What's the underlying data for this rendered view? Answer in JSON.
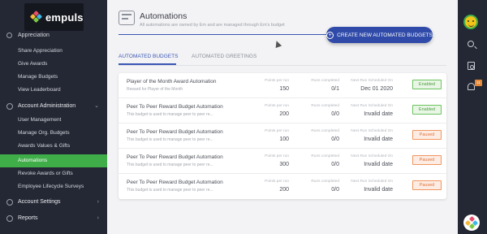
{
  "brand": {
    "name": "empuls"
  },
  "sidebar": {
    "cut_section": "Appreciation",
    "appreciation_items": [
      {
        "label": "Share Appreciation"
      },
      {
        "label": "Give Awards"
      },
      {
        "label": "Manage Budgets"
      },
      {
        "label": "View Leaderboard"
      }
    ],
    "account_admin": {
      "label": "Account Administration"
    },
    "admin_items": [
      {
        "label": "User Management"
      },
      {
        "label": "Manage Org. Budgets"
      },
      {
        "label": "Awards Values & Gifts"
      },
      {
        "label": "Automations",
        "active": true
      },
      {
        "label": "Revoke Awards or Gifts"
      },
      {
        "label": "Employee Lifecycle Surveys"
      }
    ],
    "account_settings": {
      "label": "Account Settings"
    },
    "reports": {
      "label": "Reports"
    }
  },
  "header": {
    "title": "Automations",
    "subtitle": "All automations are owned by Em and are managed through Em's budget",
    "create_button": "CREATE NEW AUTOMATED BUDGETS"
  },
  "tabs": [
    {
      "label": "AUTOMATED BUDGETS",
      "active": true
    },
    {
      "label": "AUTOMATED GREETINGS",
      "active": false
    }
  ],
  "columns": {
    "points": "Points per run",
    "runs": "Runs completed",
    "next": "Next Run Scheduled On"
  },
  "rows": [
    {
      "name": "Player of the Month Award Automation",
      "desc": "Reward for Player of the Month",
      "points": "150",
      "runs": "0/1",
      "next": "Dec 01 2020",
      "status": "Enabled"
    },
    {
      "name": "Peer To Peer Reward Budget Automation",
      "desc": "This budget is used to manage peer to peer re...",
      "points": "200",
      "runs": "0/0",
      "next": "Invalid date",
      "status": "Enabled"
    },
    {
      "name": "Peer To Peer Reward Budget Automation",
      "desc": "This budget is used to manage peer to peer re...",
      "points": "100",
      "runs": "0/0",
      "next": "Invalid date",
      "status": "Paused"
    },
    {
      "name": "Peer To Peer Reward Budget Automation",
      "desc": "This budget is used to manage peer to peer re...",
      "points": "300",
      "runs": "0/0",
      "next": "Invalid date",
      "status": "Paused"
    },
    {
      "name": "Peer To Peer Reward Budget Automation",
      "desc": "This budget is used to manage peer to peer re...",
      "points": "200",
      "runs": "0/0",
      "next": "Invalid date",
      "status": "Paused"
    }
  ],
  "rightbar": {
    "notification_count": "11"
  },
  "colors": {
    "accent": "#3a55b4",
    "active_nav": "#3fae49",
    "enabled": "#4e9e42",
    "paused": "#e0733a"
  },
  "icons": [
    "search-icon",
    "document-icon",
    "bell-icon",
    "avatar",
    "help-icon"
  ]
}
